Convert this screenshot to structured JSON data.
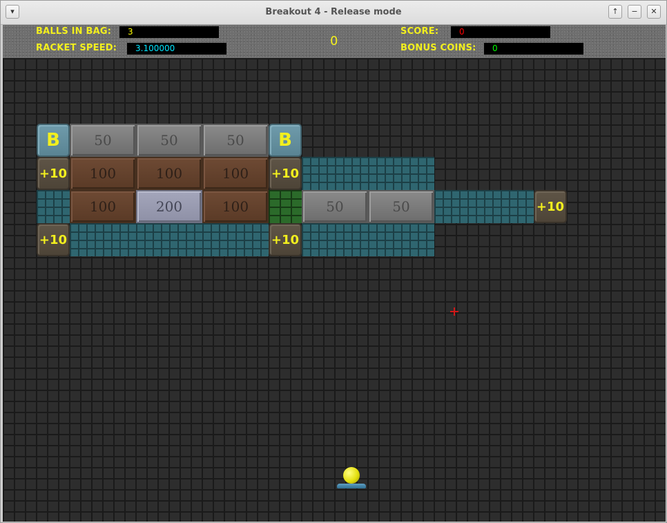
{
  "window": {
    "title": "Breakout 4 - Release mode",
    "menu_glyph": "▾",
    "up_glyph": "↑",
    "minimize_glyph": "−",
    "close_glyph": "✕"
  },
  "hud": {
    "balls_label": "BALLS IN BAG:",
    "balls_value": "3",
    "speed_label": "RACKET SPEED:",
    "speed_value": "3.100000",
    "center_value": "0",
    "score_label": "SCORE:",
    "score_value": "0",
    "bonus_label": "BONUS COINS:",
    "bonus_value": "0"
  },
  "colors": {
    "label_yellow": "#f2ef1e",
    "balls_value": "#ffff00",
    "speed_value": "#00e5ff",
    "score_value": "#ff0000",
    "bonus_value": "#00ff00"
  },
  "bricks": {
    "b1": "B",
    "b2": "B",
    "r1c2": "50",
    "r1c3": "50",
    "r1c4": "50",
    "r2c1": "+10",
    "r2c2": "100",
    "r2c3": "100",
    "r2c4": "100",
    "r2c5": "+10",
    "r3c2": "100",
    "r3c3": "200",
    "r3c4": "100",
    "r3c7": "50",
    "r3c8": "50",
    "r3c11": "+10",
    "r4c1": "+10",
    "r4c5": "+10"
  }
}
